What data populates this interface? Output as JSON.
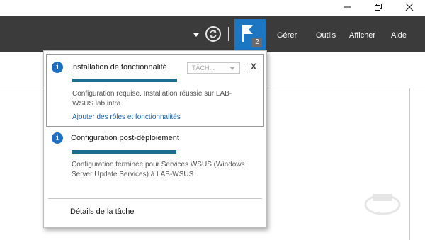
{
  "window_controls": {
    "minimize_icon": "minimize-icon",
    "restore_icon": "restore-icon",
    "close_icon": "close-icon"
  },
  "toolbar": {
    "notification_count": "2",
    "menu": [
      "Gérer",
      "Outils",
      "Afficher",
      "Aide"
    ]
  },
  "notifications": [
    {
      "title": "Installation de fonctionnalité",
      "task_select": "TÂCH...",
      "close": "X",
      "description": "Configuration requise. Installation réussie sur LAB-WSUS.lab.intra.",
      "link": "Ajouter des rôles et fonctionnalités",
      "progress": 1.0
    },
    {
      "title": "Configuration post-déploiement",
      "description": "Configuration terminée pour Services WSUS (Windows Server Update Services) à LAB-WSUS",
      "progress": 1.0
    }
  ],
  "footer_link": "Détails de la tâche",
  "colors": {
    "menubar": "#3b3b3b",
    "accent": "#1d76c2",
    "progress": "#1b6e8f",
    "link": "#1a64b3"
  }
}
